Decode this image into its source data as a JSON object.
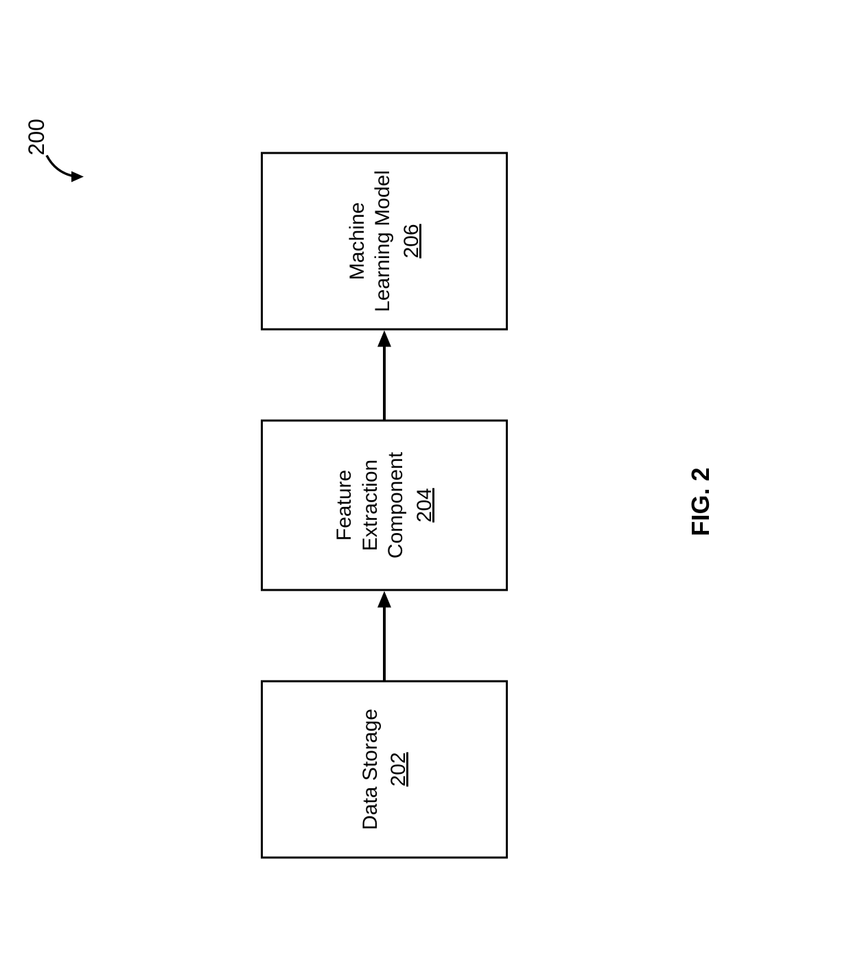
{
  "figure": {
    "caption": "FIG. 2",
    "overall_ref": "200"
  },
  "blocks": {
    "data_storage": {
      "label": "Data Storage",
      "ref": "202"
    },
    "feature_extraction": {
      "label_line1": "Feature",
      "label_line2": "Extraction",
      "label_line3": "Component",
      "ref": "204"
    },
    "ml_model": {
      "label_line1": "Machine",
      "label_line2": "Learning Model",
      "ref": "206"
    }
  }
}
